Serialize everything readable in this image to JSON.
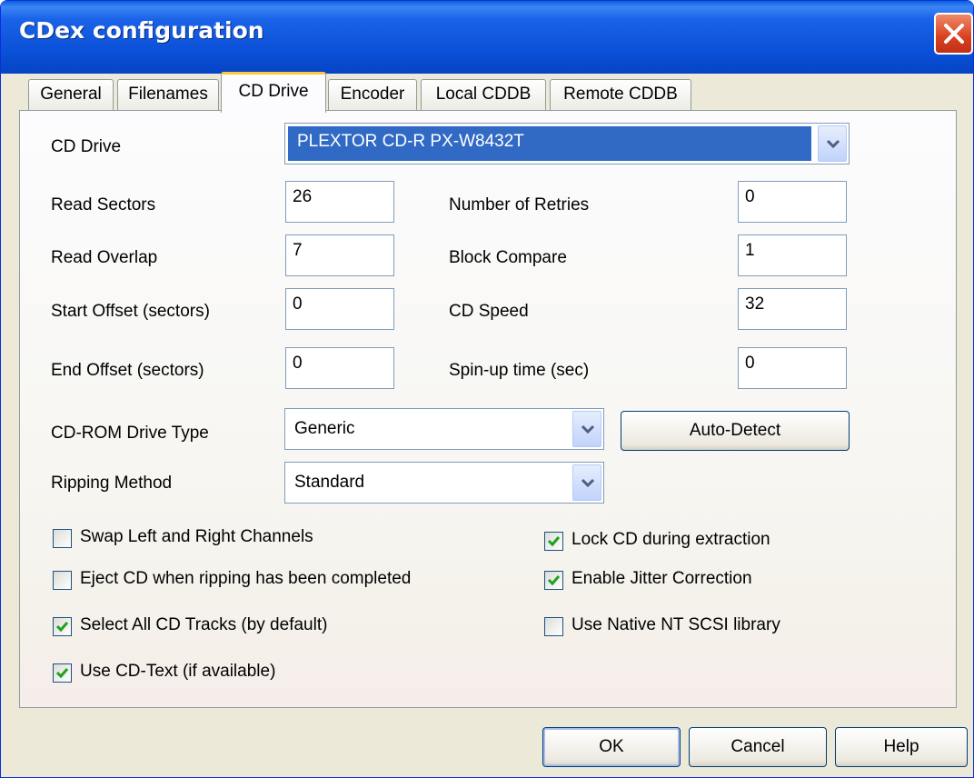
{
  "window": {
    "title": "CDex configuration"
  },
  "tabs": [
    {
      "label": "General"
    },
    {
      "label": "Filenames"
    },
    {
      "label": "CD Drive"
    },
    {
      "label": "Encoder"
    },
    {
      "label": "Local CDDB"
    },
    {
      "label": "Remote CDDB"
    }
  ],
  "drive": {
    "label": "CD Drive",
    "value": "PLEXTOR CD-R   PX-W8432T"
  },
  "fields": {
    "read_sectors": {
      "label": "Read Sectors",
      "value": "26"
    },
    "read_overlap": {
      "label": "Read Overlap",
      "value": "7"
    },
    "start_offset": {
      "label": "Start Offset (sectors)",
      "value": "0"
    },
    "end_offset": {
      "label": "End Offset (sectors)",
      "value": "0"
    },
    "retries": {
      "label": "Number of Retries",
      "value": "0"
    },
    "block_compare": {
      "label": "Block Compare",
      "value": "1"
    },
    "cd_speed": {
      "label": "CD Speed",
      "value": "32"
    },
    "spinup": {
      "label": "Spin-up time (sec)",
      "value": "0"
    }
  },
  "drive_type": {
    "label": "CD-ROM Drive Type",
    "value": "Generic"
  },
  "ripping": {
    "label": "Ripping Method",
    "value": "Standard"
  },
  "auto_detect": "Auto-Detect",
  "checkboxes": {
    "swap": {
      "label": "Swap Left and Right Channels",
      "checked": false
    },
    "eject": {
      "label": "Eject CD when ripping has been completed",
      "checked": false
    },
    "select_all": {
      "label": "Select All CD Tracks (by default)",
      "checked": true
    },
    "cdtext": {
      "label": "Use CD-Text (if available)",
      "checked": true
    },
    "lock": {
      "label": "Lock CD during extraction",
      "checked": true
    },
    "jitter": {
      "label": "Enable Jitter Correction",
      "checked": true
    },
    "native": {
      "label": "Use Native NT SCSI library",
      "checked": false
    }
  },
  "buttons": {
    "ok": "OK",
    "cancel": "Cancel",
    "help": "Help"
  },
  "colors": {
    "title_bar": "#0a50d8",
    "selection": "#316ac5",
    "check": "#21a121",
    "close": "#d8401e"
  }
}
